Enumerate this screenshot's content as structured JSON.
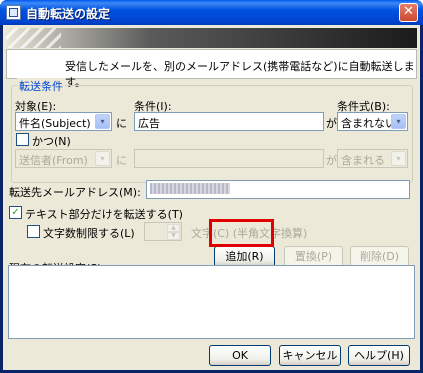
{
  "window": {
    "title": "自動転送の設定",
    "close_glyph": "✕"
  },
  "description": "受信したメールを、別のメールアドレス(携帯電話など)に自動転送します。",
  "conditions": {
    "group_label": "転送条件",
    "target_label": "対象(E):",
    "target_value": "件名(Subject)",
    "ni1": "に",
    "condition_label": "条件(I):",
    "condition_value": "広告",
    "ga1": "が",
    "expr_label": "条件式(B):",
    "expr_value": "含まれない",
    "and_label": "かつ(N)",
    "target2_value": "送信者(From)",
    "ni2": "に",
    "condition2_value": "",
    "ga2": "が",
    "expr2_value": "含まれる"
  },
  "forward": {
    "address_label": "転送先メールアドレス(M):",
    "text_only_label": "テキスト部分だけを転送する(T)",
    "text_only_checked": true,
    "limit_label": "文字数制限する(L)",
    "limit_checked": false,
    "limit_value": "",
    "limit_unit_label": "文字(C) (半角文字換算)"
  },
  "buttons": {
    "add": "追加(R)",
    "replace": "置換(P)",
    "delete": "削除(D)",
    "ok": "OK",
    "cancel": "キャンセル",
    "help": "ヘルプ(H)"
  },
  "current": {
    "label": "現在の転送設定(S):",
    "items": []
  },
  "icons": {
    "dropdown": "▾",
    "check": "✓",
    "spin_up": "▲",
    "spin_down": "▼"
  }
}
